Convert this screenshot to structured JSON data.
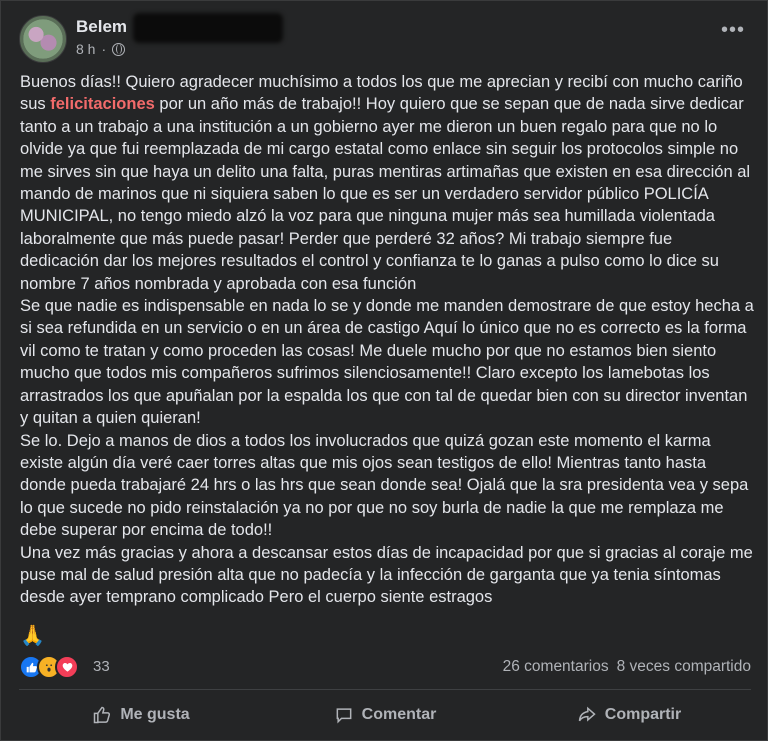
{
  "post": {
    "author": "Belem",
    "time": "8 h",
    "more": "•••",
    "paragraphs": [
      {
        "before": "Buenos días!! Quiero agradecer muchísimo a todos los que me aprecian y recibí con mucho cariño sus ",
        "highlight": "felicitaciones",
        "after": " por un año más de trabajo!! Hoy quiero que se sepan que de nada sirve dedicar tanto a un trabajo a una institución a un gobierno  ayer me dieron un buen regalo para que no lo olvide ya que fui reemplazada de mi cargo estatal como enlace sin seguir los protocolos simple no me sirves sin que haya un delito una falta, puras mentiras artimañas que existen en esa dirección al mando de marinos que ni siquiera saben lo que es ser un verdadero servidor público POLICÍA MUNICIPAL,  no tengo miedo alzó la voz para que ninguna mujer más sea humillada violentada laboralmente que más puede pasar! Perder que perderé 32 años?  Mi trabajo siempre fue dedicación dar los mejores resultados el control y confianza te lo ganas a pulso como lo dice su nombre 7 años nombrada y aprobada con esa función"
      },
      {
        "before": "",
        "highlight": "",
        "after": "Se que nadie es indispensable en nada lo se y donde me manden demostrare de que estoy hecha a si sea refundida en un servicio o en un área de castigo   Aquí lo único que no es correcto es la forma vil como te tratan y como proceden las cosas!   Me duele mucho por que no estamos bien siento mucho que todos mis compañeros sufrimos silenciosamente!! Claro excepto los lamebotas los arrastrados los que apuñalan por la espalda los que con tal de quedar bien con su director inventan y quitan a quien quieran!"
      },
      {
        "before": "",
        "highlight": "",
        "after": "Se lo. Dejo a manos de dios a todos los involucrados que quizá gozan este momento el karma existe algún día veré caer torres altas que mis ojos sean testigos de ello! Mientras tanto hasta donde pueda trabajaré 24 hrs o las hrs que sean donde sea! Ojalá que la sra presidenta vea y sepa lo que sucede no pido reinstalación ya no por que no soy burla de nadie la que me remplaza me debe superar por encima de todo!!"
      },
      {
        "before": "",
        "highlight": "",
        "after": "Una vez más gracias y ahora a descansar estos días de incapacidad por que si gracias al coraje me puse mal de salud presión alta que no padecía y la infección de garganta que ya tenia síntomas desde ayer temprano complicado Pero el cuerpo siente estragos"
      }
    ],
    "emoji": "🙏"
  },
  "stats": {
    "reaction_count": "33",
    "comments": "26 comentarios",
    "shares": "8 veces compartido"
  },
  "actions": {
    "like": "Me gusta",
    "comment": "Comentar",
    "share": "Compartir"
  },
  "colors": {
    "background": "#242526",
    "highlight": "#f26b6b",
    "secondary_text": "#b0b3b8"
  }
}
